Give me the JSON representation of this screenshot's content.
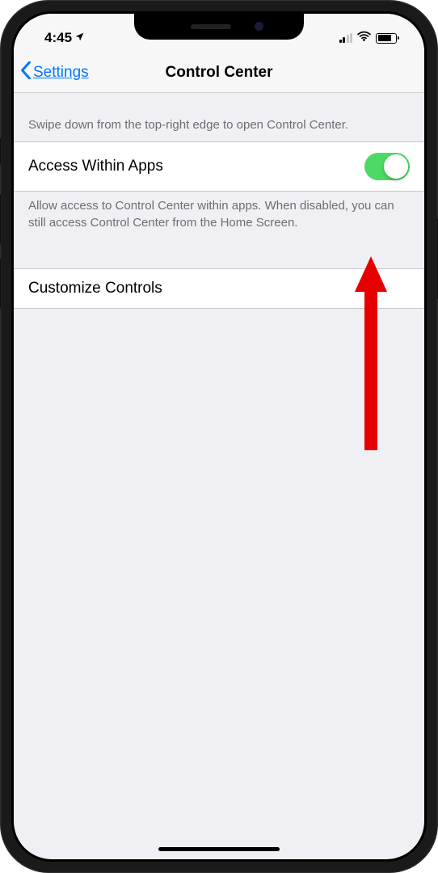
{
  "status": {
    "time": "4:45"
  },
  "nav": {
    "back_label": "Settings",
    "title": "Control Center"
  },
  "sections": {
    "intro_text": "Swipe down from the top-right edge to open Control Center.",
    "access_within_apps_label": "Access Within Apps",
    "access_within_apps_on": true,
    "access_footer": "Allow access to Control Center within apps. When disabled, you can still access Control Center from the Home Screen.",
    "customize_label": "Customize Controls"
  }
}
